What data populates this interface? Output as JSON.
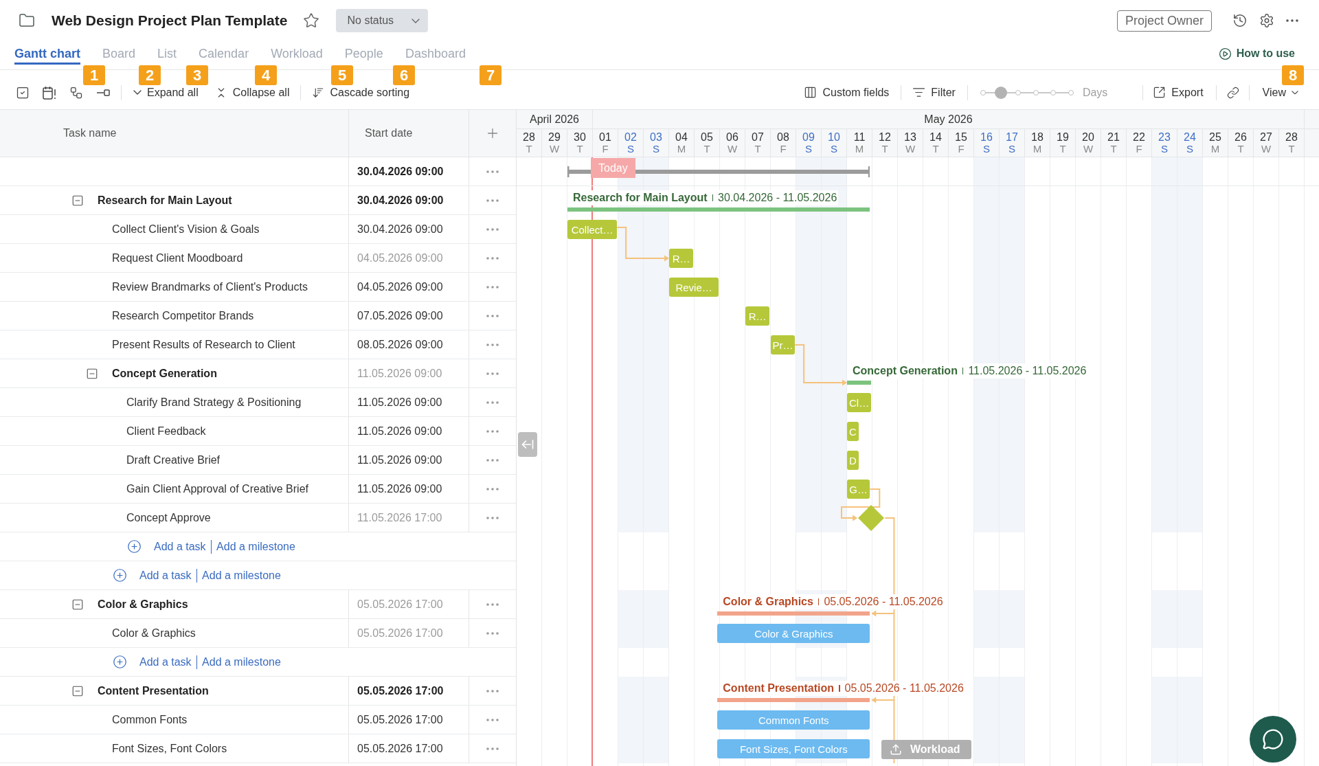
{
  "header": {
    "title": "Web Design Project Plan Template",
    "status": "No status",
    "owner": "Project Owner"
  },
  "tabs": [
    {
      "label": "Gantt chart",
      "selected": true
    },
    {
      "label": "Board",
      "selected": false
    },
    {
      "label": "List",
      "selected": false
    },
    {
      "label": "Calendar",
      "selected": false
    },
    {
      "label": "Workload",
      "selected": false
    },
    {
      "label": "People",
      "selected": false
    },
    {
      "label": "Dashboard",
      "selected": false
    }
  ],
  "help_link": "How to use",
  "toolbar": {
    "actions": [
      "Expand all",
      "Collapse all",
      "Cascade sorting"
    ],
    "custom_fields": "Custom fields",
    "filter": "Filter",
    "zoom": {
      "level": 0.2,
      "label": "Days"
    },
    "export": "Export",
    "view": "View"
  },
  "table": {
    "columns": [
      "Task name",
      "Start date"
    ],
    "rows": [
      {
        "kind": "project",
        "start": "30.04.2026 09:00",
        "date_bold": true,
        "date_muted": false,
        "bar": {
          "kind": "project"
        },
        "children": [
          {
            "kind": "group",
            "name": "Research for Main Layout",
            "expanded": true,
            "start": "30.04.2026 09:00",
            "date_bold": true,
            "date_muted": false,
            "bar": {
              "kind": "summary",
              "label": "Research for Main Layout",
              "dates": "30.04.2026 - 11.05.2026",
              "color": "#7cc380"
            },
            "children": [
              {
                "kind": "task",
                "name": "Collect Client's Vision & Goals",
                "start": "30.04.2026 09:00",
                "date_bold": false,
                "date_muted": false,
                "bar": {
                  "kind": "task",
                  "label": "Collect…",
                  "color": "#b6c83a"
                }
              },
              {
                "kind": "task",
                "name": "Request Client Moodboard",
                "start": "04.05.2026 09:00",
                "date_bold": false,
                "date_muted": true,
                "bar": {
                  "kind": "task",
                  "label": "R…",
                  "color": "#b6c83a"
                }
              },
              {
                "kind": "task",
                "name": "Review Brandmarks of Client's Products",
                "start": "04.05.2026 09:00",
                "date_bold": false,
                "date_muted": false,
                "bar": {
                  "kind": "task",
                  "label": "Revie…",
                  "color": "#b6c83a"
                }
              },
              {
                "kind": "task",
                "name": "Research Competitor Brands",
                "start": "07.05.2026 09:00",
                "date_bold": false,
                "date_muted": false,
                "bar": {
                  "kind": "task",
                  "label": "R…",
                  "color": "#b6c83a"
                }
              },
              {
                "kind": "task",
                "name": "Present Results of Research to Client",
                "start": "08.05.2026 09:00",
                "date_bold": false,
                "date_muted": false,
                "bar": {
                  "kind": "task",
                  "label": "Pr…",
                  "color": "#b6c83a"
                }
              },
              {
                "kind": "group",
                "name": "Concept Generation",
                "expanded": true,
                "start": "11.05.2026 09:00",
                "date_bold": false,
                "date_muted": true,
                "bar": {
                  "kind": "summary",
                  "label": "Concept Generation",
                  "dates": "11.05.2026 - 11.05.2026",
                  "color": "#7cc380"
                },
                "children": [
                  {
                    "kind": "task",
                    "name": "Clarify Brand Strategy & Positioning",
                    "start": "11.05.2026 09:00",
                    "date_bold": false,
                    "date_muted": false,
                    "bar": {
                      "kind": "task",
                      "label": "Cl…",
                      "color": "#b6c83a"
                    }
                  },
                  {
                    "kind": "task",
                    "name": "Client Feedback",
                    "start": "11.05.2026 09:00",
                    "date_bold": false,
                    "date_muted": false,
                    "bar": {
                      "kind": "task",
                      "label": "C",
                      "color": "#b6c83a"
                    }
                  },
                  {
                    "kind": "task",
                    "name": "Draft Creative Brief",
                    "start": "11.05.2026 09:00",
                    "date_bold": false,
                    "date_muted": false,
                    "bar": {
                      "kind": "task",
                      "label": "D",
                      "color": "#b6c83a"
                    }
                  },
                  {
                    "kind": "task",
                    "name": "Gain Client Approval of Creative Brief",
                    "start": "11.05.2026 09:00",
                    "date_bold": false,
                    "date_muted": false,
                    "bar": {
                      "kind": "task",
                      "label": "G…",
                      "color": "#b6c83a"
                    }
                  },
                  {
                    "kind": "task",
                    "name": "Concept Approve",
                    "start": "11.05.2026 17:00",
                    "date_bold": false,
                    "date_muted": true,
                    "bar": {
                      "kind": "milestone",
                      "color": "#b6c83a"
                    }
                  },
                  {
                    "kind": "add",
                    "task_link": "Add a task",
                    "milestone_link": "Add a milestone"
                  }
                ]
              },
              {
                "kind": "add",
                "task_link": "Add a task",
                "milestone_link": "Add a milestone"
              }
            ]
          },
          {
            "kind": "group",
            "name": "Color & Graphics",
            "expanded": true,
            "start": "05.05.2026 17:00",
            "date_bold": false,
            "date_muted": true,
            "bar": {
              "kind": "summary",
              "label": "Color & Graphics",
              "dates": "05.05.2026 - 11.05.2026",
              "color": "#f2a48b"
            },
            "children": [
              {
                "kind": "task",
                "name": "Color & Graphics",
                "start": "05.05.2026 17:00",
                "date_bold": false,
                "date_muted": true,
                "bar": {
                  "kind": "task",
                  "label": "Color & Graphics",
                  "color": "#6cbaf0"
                }
              },
              {
                "kind": "add",
                "task_link": "Add a task",
                "milestone_link": "Add a milestone"
              }
            ]
          },
          {
            "kind": "group",
            "name": "Content Presentation",
            "expanded": true,
            "start": "05.05.2026 17:00",
            "date_bold": true,
            "date_muted": false,
            "bar": {
              "kind": "summary",
              "label": "Content Presentation",
              "dates": "05.05.2026 - 11.05.2026",
              "color": "#f2a48b"
            },
            "children": [
              {
                "kind": "task",
                "name": "Common Fonts",
                "start": "05.05.2026 17:00",
                "date_bold": false,
                "date_muted": false,
                "bar": {
                  "kind": "task",
                  "label": "Common Fonts",
                  "color": "#6cbaf0"
                }
              },
              {
                "kind": "task",
                "name": "Font Sizes, Font Colors",
                "start": "05.05.2026 17:00",
                "date_bold": false,
                "date_muted": false,
                "bar": {
                  "kind": "task",
                  "label": "Font Sizes, Font Colors",
                  "color": "#6cbaf0"
                }
              }
            ]
          }
        ]
      }
    ]
  },
  "gantt": {
    "months": [
      {
        "label": "April 2026",
        "days": [
          {
            "day": "28",
            "weekday": "T",
            "weekend": false
          },
          {
            "day": "29",
            "weekday": "W",
            "weekend": false
          },
          {
            "day": "30",
            "weekday": "T",
            "weekend": false
          }
        ]
      },
      {
        "label": "May 2026",
        "days": [
          {
            "day": "01",
            "weekday": "F",
            "weekend": false
          },
          {
            "day": "02",
            "weekday": "S",
            "weekend": true
          },
          {
            "day": "03",
            "weekday": "S",
            "weekend": true
          },
          {
            "day": "04",
            "weekday": "M",
            "weekend": false
          },
          {
            "day": "05",
            "weekday": "T",
            "weekend": false
          },
          {
            "day": "06",
            "weekday": "W",
            "weekend": false
          },
          {
            "day": "07",
            "weekday": "T",
            "weekend": false
          },
          {
            "day": "08",
            "weekday": "F",
            "weekend": false
          },
          {
            "day": "09",
            "weekday": "S",
            "weekend": true
          },
          {
            "day": "10",
            "weekday": "S",
            "weekend": true
          },
          {
            "day": "11",
            "weekday": "M",
            "weekend": false
          },
          {
            "day": "12",
            "weekday": "T",
            "weekend": false
          },
          {
            "day": "13",
            "weekday": "W",
            "weekend": false
          },
          {
            "day": "14",
            "weekday": "T",
            "weekend": false
          },
          {
            "day": "15",
            "weekday": "F",
            "weekend": false
          },
          {
            "day": "16",
            "weekday": "S",
            "weekend": true
          },
          {
            "day": "17",
            "weekday": "S",
            "weekend": true
          },
          {
            "day": "18",
            "weekday": "M",
            "weekend": false
          },
          {
            "day": "19",
            "weekday": "T",
            "weekend": false
          },
          {
            "day": "20",
            "weekday": "W",
            "weekend": false
          },
          {
            "day": "21",
            "weekday": "T",
            "weekend": false
          },
          {
            "day": "22",
            "weekday": "F",
            "weekend": false
          },
          {
            "day": "23",
            "weekday": "S",
            "weekend": true
          },
          {
            "day": "24",
            "weekday": "S",
            "weekend": true
          },
          {
            "day": "25",
            "weekday": "M",
            "weekend": false
          },
          {
            "day": "26",
            "weekday": "T",
            "weekend": false
          },
          {
            "day": "27",
            "weekday": "W",
            "weekend": false
          },
          {
            "day": "28",
            "weekday": "T",
            "weekend": false
          }
        ]
      }
    ],
    "today": "Today",
    "workload": "Workload"
  },
  "annotations": [
    "1",
    "2",
    "3",
    "4",
    "5",
    "6",
    "7",
    "8"
  ]
}
